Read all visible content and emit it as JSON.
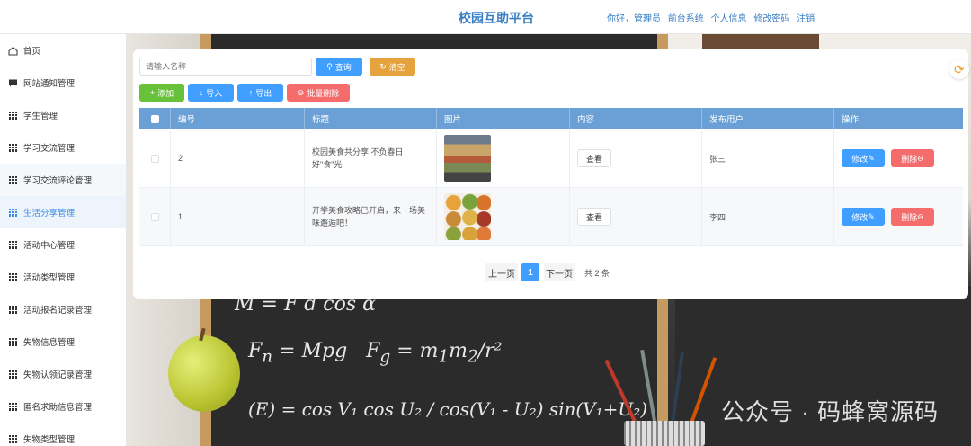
{
  "header": {
    "title": "校园互助平台",
    "links": [
      "你好，管理员",
      "前台系统",
      "个人信息",
      "修改密码",
      "注销"
    ]
  },
  "sidebar": {
    "items": [
      {
        "label": "首页",
        "icon": "home-icon"
      },
      {
        "label": "网站通知管理",
        "icon": "message-icon"
      },
      {
        "label": "学生管理",
        "icon": "grid-icon"
      },
      {
        "label": "学习交流管理",
        "icon": "grid-icon"
      },
      {
        "label": "学习交流评论管理",
        "icon": "grid-icon"
      },
      {
        "label": "生活分享管理",
        "icon": "grid-icon",
        "active": true
      },
      {
        "label": "活动中心管理",
        "icon": "grid-icon"
      },
      {
        "label": "活动类型管理",
        "icon": "grid-icon"
      },
      {
        "label": "活动报名记录管理",
        "icon": "grid-icon"
      },
      {
        "label": "失物信息管理",
        "icon": "grid-icon"
      },
      {
        "label": "失物认领记录管理",
        "icon": "grid-icon"
      },
      {
        "label": "匿名求助信息管理",
        "icon": "grid-icon"
      },
      {
        "label": "失物类型管理",
        "icon": "grid-icon"
      }
    ]
  },
  "search": {
    "placeholder": "请输入名称",
    "query_label": "查询",
    "clear_label": "清空"
  },
  "toolbar": {
    "add_label": "添加",
    "import_label": "导入",
    "export_label": "导出",
    "batch_delete_label": "批量删除"
  },
  "table": {
    "columns": [
      "编号",
      "标题",
      "图片",
      "内容",
      "发布用户",
      "操作"
    ],
    "rows": [
      {
        "id": "2",
        "title": "校园美食共分享 不负春日好\"食\"光",
        "content_btn": "查看",
        "user": "张三",
        "edit": "修改",
        "delete": "删除"
      },
      {
        "id": "1",
        "title": "开学美食攻略已开启，来一场美味邂逅吧！",
        "content_btn": "查看",
        "user": "李四",
        "edit": "修改",
        "delete": "删除"
      }
    ]
  },
  "pagination": {
    "prev": "上一页",
    "current": "1",
    "next": "下一页",
    "total": "共 2 条"
  },
  "background": {
    "watermark": "公众号 · 码蜂窝源码"
  },
  "colors": {
    "primary": "#409eff",
    "warning": "#e6a23c",
    "success": "#67c23a",
    "danger": "#f56c6c",
    "table_header": "#6aa0d6",
    "title": "#3a7fc4"
  }
}
